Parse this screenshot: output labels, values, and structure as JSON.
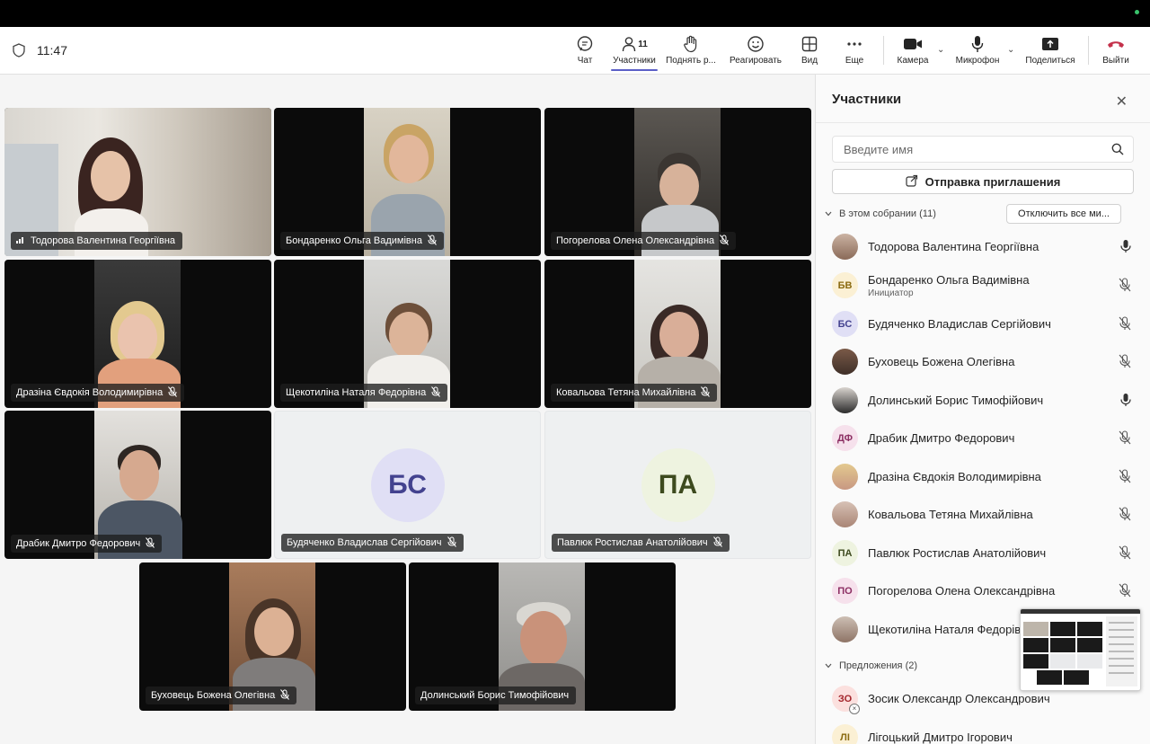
{
  "toolbar": {
    "time": "11:47",
    "participants_count": "11",
    "buttons": {
      "chat": "Чат",
      "participants": "Участники",
      "raise_hand": "Поднять р...",
      "react": "Реагировать",
      "view": "Вид",
      "more": "Еще",
      "camera": "Камера",
      "mic": "Микрофон",
      "share": "Поделиться",
      "leave": "Выйти"
    },
    "leave_color": "#c4314b"
  },
  "grid": {
    "tiles": [
      {
        "name": "Тодорова Валентина Георгіївна"
      },
      {
        "name": "Бондаренко Ольга Вадимівна"
      },
      {
        "name": "Погорелова Олена Олександрівна"
      },
      {
        "name": "Дразіна Євдокія Володимирівна"
      },
      {
        "name": "Щекотиліна Наталя Федорівна"
      },
      {
        "name": "Ковальова Тетяна Михайлівна"
      },
      {
        "name": "Драбик Дмитро Федорович"
      },
      {
        "name": "Будяченко Владислав Сергійович",
        "initials": "БС"
      },
      {
        "name": "Павлюк Ростислав Анатолійович",
        "initials": "ПА"
      },
      {
        "name": "Буховець Божена Олегівна"
      },
      {
        "name": "Долинський Борис Тимофійович"
      }
    ]
  },
  "panel": {
    "title": "Участники",
    "search_placeholder": "Введите имя",
    "invite_label": "Отправка приглашения",
    "in_meeting_label": "В этом собрании (11)",
    "mute_all_label": "Отключить все ми...",
    "suggestions_label": "Предложения (2)",
    "participants": [
      {
        "name": "Тодорова Валентина Георгіївна",
        "mic": "on"
      },
      {
        "name": "Бондаренко Ольга Вадимівна",
        "role": "Инициатор",
        "initials": "БВ",
        "mic": "off"
      },
      {
        "name": "Будяченко Владислав Сергійович",
        "initials": "БС",
        "mic": "off"
      },
      {
        "name": "Буховець Божена Олегівна",
        "mic": "off"
      },
      {
        "name": "Долинський Борис Тимофійович",
        "mic": "on"
      },
      {
        "name": "Драбик Дмитро Федорович",
        "initials": "ДФ",
        "mic": "off"
      },
      {
        "name": "Дразіна Євдокія Володимирівна",
        "mic": "off"
      },
      {
        "name": "Ковальова Тетяна Михайлівна",
        "mic": "off"
      },
      {
        "name": "Павлюк Ростислав Анатолійович",
        "initials": "ПА",
        "mic": "off"
      },
      {
        "name": "Погорелова Олена Олександрівна",
        "initials": "ПО",
        "mic": "off"
      },
      {
        "name": "Щекотиліна Наталя Федорівна",
        "mic": "off"
      }
    ],
    "suggestions": [
      {
        "name": "Зосик Олександр Олександрович",
        "initials": "ЗО"
      },
      {
        "name": "Лігоцький Дмитро Ігорович",
        "initials": "ЛІ"
      }
    ]
  },
  "colors": {
    "accent": "#5b5fc7",
    "bs_avatar": "#e0dff5",
    "pa_avatar": "#eef3e0"
  }
}
